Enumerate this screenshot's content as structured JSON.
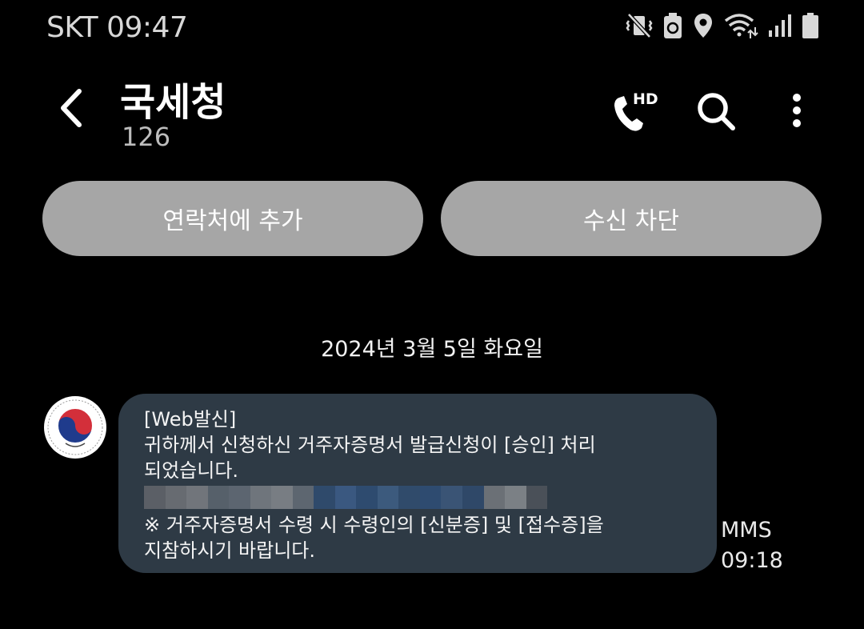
{
  "status_bar": {
    "carrier_time": "SKT 09:47",
    "icons": [
      "vibrate-mute-icon",
      "battery-saver-icon",
      "location-icon",
      "wifi-icon",
      "signal-icon",
      "battery-icon"
    ]
  },
  "header": {
    "contact_name": "국세청",
    "contact_number": "126",
    "hd_label": "HD",
    "icons": [
      "back-arrow-icon",
      "hd-call-icon",
      "search-icon",
      "more-options-icon"
    ]
  },
  "actions": {
    "add_contact_label": "연락처에 추가",
    "block_label": "수신 차단"
  },
  "conversation": {
    "date_separator": "2024년 3월 5일 화요일",
    "sender_avatar_seal_text": "국세청",
    "message": {
      "lines": [
        "[Web발신]",
        "귀하께서 신청하신 거주자증명서 발급신청이 [승인] 처리",
        "되었습니다.",
        "※ 거주자증명서 수령 시 수령인의 [신분증] 및 [접수증]을",
        "지참하시기 바랍니다."
      ],
      "redacted_colors": [
        "#5b5f66",
        "#676b71",
        "#71757b",
        "#56606a",
        "#5c6570",
        "#6f757c",
        "#787d83",
        "#5d6670",
        "#2f4a6b",
        "#3a5880",
        "#2e4b6f",
        "#3c5a7d",
        "#304b6b",
        "#2e4b70",
        "#3a5475",
        "#2f4868",
        "#6b7076",
        "#7b8085",
        "#4a5058"
      ]
    },
    "message_type": "MMS",
    "message_time": "09:18"
  },
  "colors": {
    "background": "#000000",
    "bubble": "#2e3a45",
    "action_button": "#a6a6a6"
  }
}
